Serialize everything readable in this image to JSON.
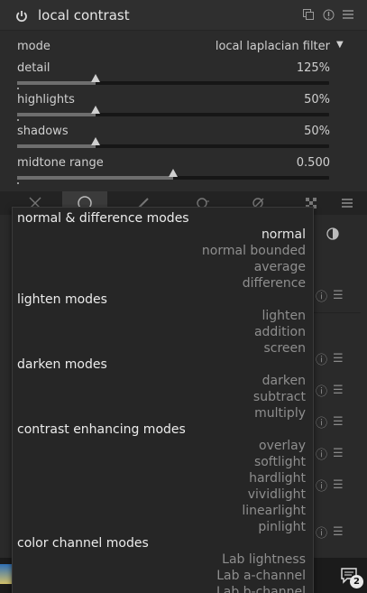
{
  "module": {
    "title": "local contrast",
    "mode_label": "mode",
    "mode_value": "local laplacian filter",
    "sliders": [
      {
        "label": "detail",
        "value": "125%",
        "fraction": 0.25
      },
      {
        "label": "highlights",
        "value": "50%",
        "fraction": 0.25
      },
      {
        "label": "shadows",
        "value": "50%",
        "fraction": 0.25
      },
      {
        "label": "midtone range",
        "value": "0.500",
        "fraction": 0.5
      }
    ]
  },
  "blend_dropdown": {
    "groups": [
      {
        "title": "normal & difference modes",
        "options": [
          "normal",
          "normal bounded",
          "average",
          "difference"
        ]
      },
      {
        "title": "lighten modes",
        "options": [
          "lighten",
          "addition",
          "screen"
        ]
      },
      {
        "title": "darken modes",
        "options": [
          "darken",
          "subtract",
          "multiply"
        ]
      },
      {
        "title": "contrast enhancing modes",
        "options": [
          "overlay",
          "softlight",
          "hardlight",
          "vividlight",
          "linearlight",
          "pinlight"
        ]
      },
      {
        "title": "color channel modes",
        "options": [
          "Lab lightness",
          "Lab a-channel",
          "Lab b-channel"
        ]
      }
    ],
    "selected": "normal"
  },
  "taskbar": {
    "notification_count": "2"
  },
  "colors": {
    "background": "#2b2b2b",
    "popup": "#262626",
    "text_dim": "#8e8e8e",
    "text_bright": "#ececec"
  }
}
